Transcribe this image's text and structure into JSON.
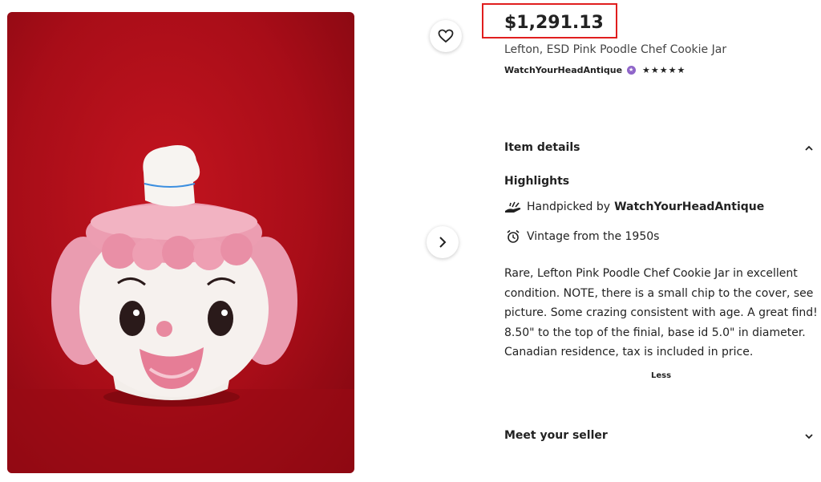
{
  "listing": {
    "price": "$1,291.13",
    "title": "Lefton, ESD Pink Poodle Chef Cookie Jar",
    "shop_name": "WatchYourHeadAntique",
    "rating_stars": "★★★★★",
    "rating_value": 5
  },
  "item_details": {
    "header": "Item details",
    "highlights_label": "Highlights",
    "handpicked_prefix": "Handpicked by",
    "handpicked_shop": "WatchYourHeadAntique",
    "vintage_text": "Vintage from the 1950s",
    "description": "Rare, Lefton Pink Poodle Chef Cookie Jar in excellent condition. NOTE, there is a small chip to the cover, see picture. Some crazing consistent with age. A great find! 8.50\" to the top of the finial, base id 5.0\" in diameter. Canadian residence, tax is included in price.",
    "less_label": "Less"
  },
  "meet_seller": {
    "header": "Meet your seller"
  },
  "colors": {
    "price_highlight_border": "#e01e1e",
    "star_seller_badge": "#8f65c9",
    "photo_background": "#b00f1a"
  },
  "icons": [
    "heart-icon",
    "chevron-right-icon",
    "star-seller-badge-icon",
    "chevron-up-icon",
    "hand-icon",
    "alarm-clock-icon",
    "chevron-down-icon"
  ]
}
